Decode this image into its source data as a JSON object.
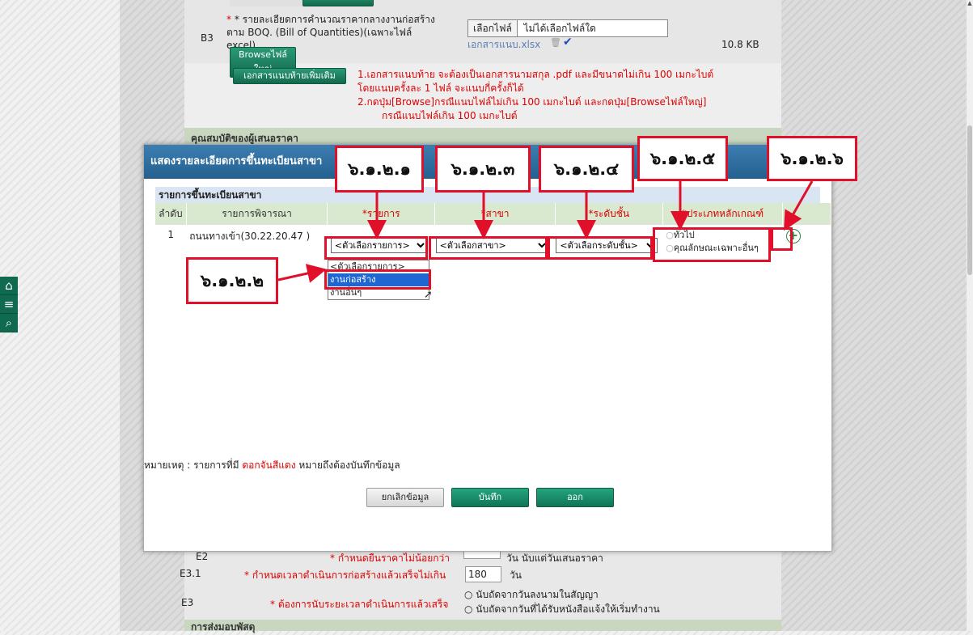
{
  "background_form": {
    "b3_code": "B3",
    "b3_desc": "* รายละเอียดการคำนวณราคากลางงานก่อสร้างตาม BOQ. (Bill of Quantities)(เฉพาะไฟล์ excel)",
    "browse_large_label": "Browseไฟล์ใหญ่",
    "file_choose_label": "เลือกไฟล์",
    "file_none_label": "ไม่ได้เลือกไฟล์ใด",
    "attached_file_name": "เอกสารแนบ.xlsx",
    "attached_file_size": "10.8 KB",
    "more_attachments_button": "เอกสารแนบท้ายเพิ่มเติม",
    "notes": [
      "1.เอกสารแนบท้าย จะต้องเป็นเอกสารนามสกุล .pdf และมีขนาดไม่เกิน 100 เมกะไบต์",
      "โดยแนบครั้งละ 1 ไฟล์ จะแนบกี่ครั้งก็ได้",
      "2.กดปุ่ม[Browse]กรณีแนบไฟล์ไม่เกิน 100 เมกะไบต์ และกดปุ่ม[Browseไฟล์ใหญ่]",
      "กรณีแนบไฟล์เกิน 100 เมกะไบต์"
    ],
    "partial_heading": "คุณสมบัติของผู้เสนอราคา",
    "e2_code": "E2",
    "e2_desc": "* กำหนดยืนราคาไม่น้อยกว่า",
    "e2_suffix": "วัน นับแต่วันเสนอราคา",
    "e31_code": "E3.1",
    "e31_desc": "* กำหนดเวลาดำเนินการก่อสร้างแล้วเสร็จไม่เกิน",
    "e31_value": "180",
    "e31_unit": "วัน",
    "e3_code": "E3",
    "e3_desc": "* ต้องการนับระยะเวลาดำเนินการแล้วเสร็จ",
    "e3_opt1": "นับถัดจากวันลงนามในสัญญา",
    "e3_opt2": "นับถัดจากวันที่ได้รับหนังสือแจ้งให้เริ่มทำงาน",
    "bottom_heading": "การส่งมอบพัสดุ"
  },
  "sidebar_tools": [
    "home-icon",
    "menu-icon",
    "search-icon"
  ],
  "modal": {
    "title": "แสดงรายละเอียดการขึ้นทะเบียนสาขา",
    "section_title": "รายการขึ้นทะเบียนสาขา",
    "columns": [
      "ลำดับ",
      "รายการพิจารณา",
      "*รายการ",
      "*สาขา",
      "*ระดับชั้น",
      "*ประเภทหลักเกณฑ์"
    ],
    "rows": [
      {
        "no": "1",
        "item": "ถนนทางเข้า(30.22.20.47 )",
        "item_select": "<ตัวเลือกรายการ>",
        "branch_select": "<ตัวเลือกสาขา>",
        "level_select": "<ตัวเลือกระดับชั้น>",
        "criteria_opt1": "ทั่วไป",
        "criteria_opt2": "คุณลักษณะเฉพาะอื่นๆ"
      }
    ],
    "dropdown_options": [
      "<ตัวเลือกรายการ>",
      "งานก่อสร้าง",
      "งานอื่นๆ"
    ],
    "dropdown_highlighted": "งานก่อสร้าง",
    "footnote_prefix": "หมายเหตุ : รายการที่มี ",
    "footnote_red": "ดอกจันสีแดง",
    "footnote_suffix": " หมายถึงต้องบันทึกข้อมูล",
    "buttons": {
      "cancel": "ยกเลิกข้อมูล",
      "save": "บันทึก",
      "exit": "ออก"
    }
  },
  "callouts": {
    "c1": "๖.๑.๒.๑",
    "c2": "๖.๑.๒.๒",
    "c3": "๖.๑.๒.๓",
    "c4": "๖.๑.๒.๔",
    "c5": "๖.๑.๒.๕",
    "c6": "๖.๑.๒.๖"
  },
  "colors": {
    "accent_red": "#e0102a",
    "header_blue": "#2f6fa0",
    "green": "#13684d"
  }
}
